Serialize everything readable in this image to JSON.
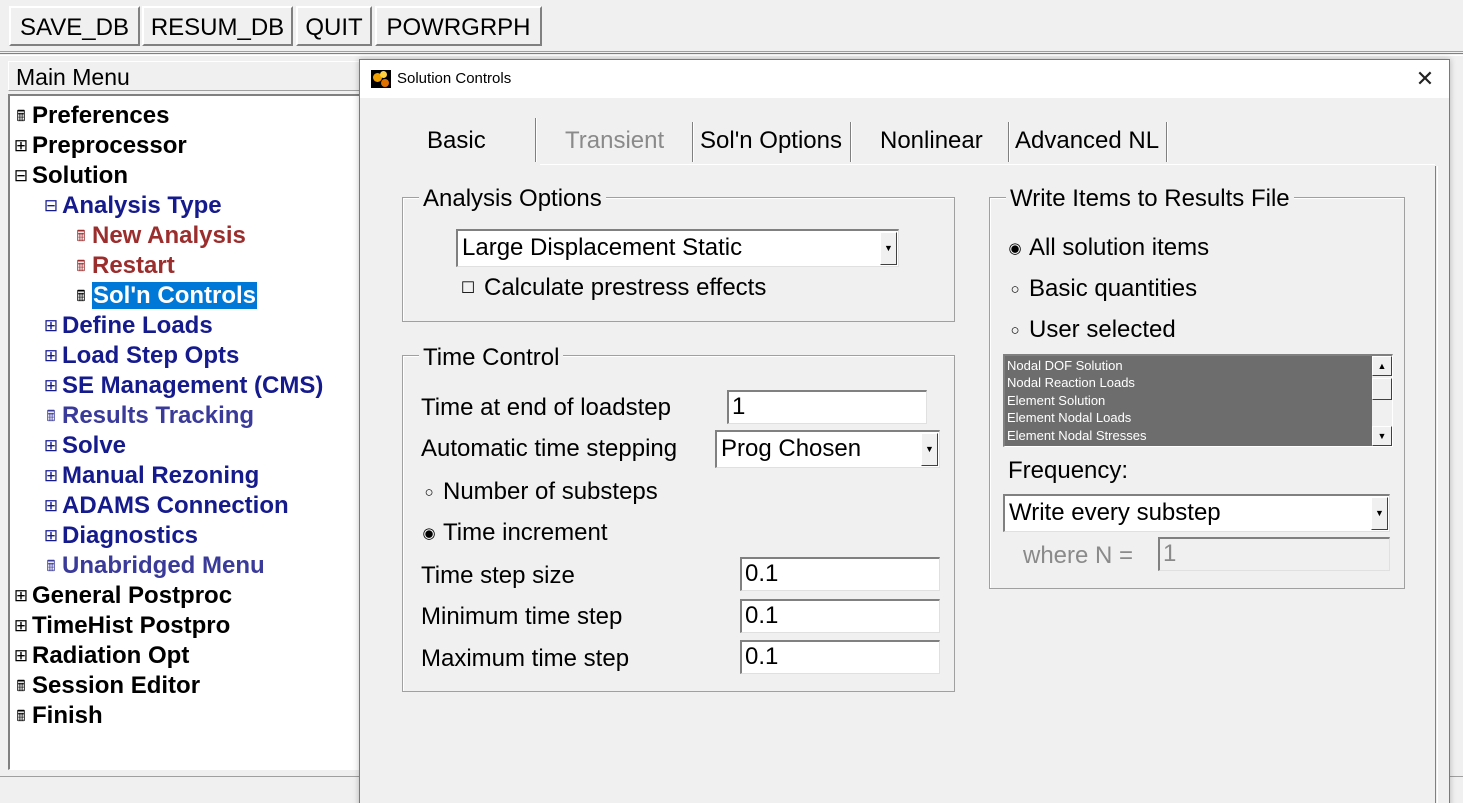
{
  "toolbar": {
    "buttons": [
      "SAVE_DB",
      "RESUM_DB",
      "QUIT",
      "POWRGRPH"
    ]
  },
  "main_menu": {
    "header": "Main Menu",
    "items": [
      {
        "label": "Preferences",
        "icon": "calculator-icon"
      },
      {
        "label": "Preprocessor",
        "icon": "expand-plus-icon"
      },
      {
        "label": "Solution",
        "icon": "collapse-minus-icon"
      },
      {
        "label": "Analysis Type",
        "icon": "collapse-minus-icon"
      },
      {
        "label": "New Analysis",
        "icon": "calculator-icon"
      },
      {
        "label": "Restart",
        "icon": "calculator-icon"
      },
      {
        "label": "Sol'n Controls",
        "icon": "calculator-icon"
      },
      {
        "label": "Define Loads",
        "icon": "expand-plus-icon"
      },
      {
        "label": "Load Step Opts",
        "icon": "expand-plus-icon"
      },
      {
        "label": "SE Management (CMS)",
        "icon": "expand-plus-icon"
      },
      {
        "label": "Results Tracking",
        "icon": "calculator-icon"
      },
      {
        "label": "Solve",
        "icon": "expand-plus-icon"
      },
      {
        "label": "Manual Rezoning",
        "icon": "expand-plus-icon"
      },
      {
        "label": "ADAMS Connection",
        "icon": "expand-plus-icon"
      },
      {
        "label": "Diagnostics",
        "icon": "expand-plus-icon"
      },
      {
        "label": "Unabridged Menu",
        "icon": "calculator-icon"
      },
      {
        "label": "General Postproc",
        "icon": "expand-plus-icon"
      },
      {
        "label": "TimeHist Postpro",
        "icon": "expand-plus-icon"
      },
      {
        "label": "Radiation Opt",
        "icon": "expand-plus-icon"
      },
      {
        "label": "Session Editor",
        "icon": "calculator-icon"
      },
      {
        "label": "Finish",
        "icon": "calculator-icon"
      }
    ]
  },
  "dialog": {
    "title": "Solution Controls",
    "close_glyph": "✕",
    "tabs": [
      "Basic",
      "Transient",
      "Sol'n Options",
      "Nonlinear",
      "Advanced NL"
    ],
    "analysis_options": {
      "title": "Analysis Options",
      "analysis_type": "Large Displacement Static",
      "prestress_label": "Calculate prestress effects",
      "prestress_checked": false
    },
    "time_control": {
      "title": "Time Control",
      "time_end_label": "Time at end of loadstep",
      "time_end_value": "1",
      "auto_step_label": "Automatic time stepping",
      "auto_step_value": "Prog Chosen",
      "num_substeps_label": "Number of substeps",
      "time_increment_label": "Time increment",
      "selected_option": "Time increment",
      "step_size_label": "Time step size",
      "step_size_value": "0.1",
      "min_step_label": "Minimum time step",
      "min_step_value": "0.1",
      "max_step_label": "Maximum time step",
      "max_step_value": "0.1"
    },
    "write_items": {
      "title": "Write Items to Results File",
      "options": [
        "All solution items",
        "Basic quantities",
        "User selected"
      ],
      "selected_option": "All solution items",
      "list": [
        "Nodal DOF Solution",
        "Nodal Reaction Loads",
        "Element Solution",
        "Element Nodal Loads",
        "Element Nodal Stresses"
      ],
      "frequency_label": "Frequency:",
      "frequency_value": "Write every substep",
      "where_n_label": "where N =",
      "where_n_value": "1"
    }
  },
  "colors": {
    "selection": "#0078d7",
    "menu_navy": "#151a8c",
    "menu_red": "#9b2d2d",
    "listbox_bg": "#6d6d6d"
  }
}
